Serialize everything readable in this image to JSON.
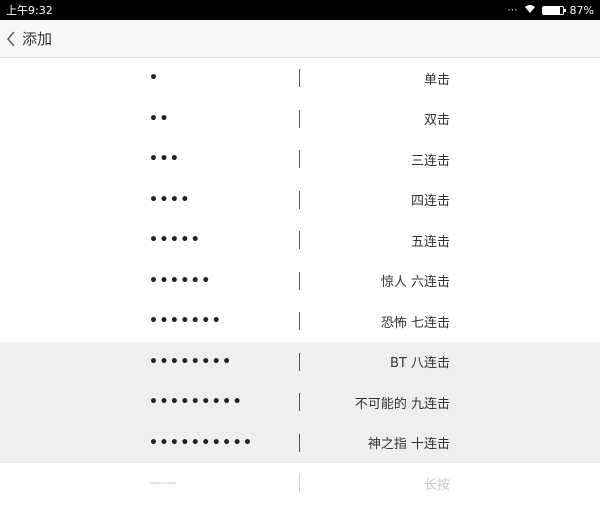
{
  "status_bar": {
    "time": "上午9:32",
    "battery": "87%",
    "battery_level": 0.87
  },
  "header": {
    "back_label": "添加"
  },
  "rows": [
    {
      "pattern": "•",
      "label": "单击",
      "state": "normal"
    },
    {
      "pattern": "••",
      "label": "双击",
      "state": "normal"
    },
    {
      "pattern": "•••",
      "label": "三连击",
      "state": "normal"
    },
    {
      "pattern": "••••",
      "label": "四连击",
      "state": "normal"
    },
    {
      "pattern": "•••••",
      "label": "五连击",
      "state": "normal"
    },
    {
      "pattern": "••••••",
      "label": "惊人 六连击",
      "state": "normal"
    },
    {
      "pattern": "•••••••",
      "label": "恐怖 七连击",
      "state": "normal"
    },
    {
      "pattern": "••••••••",
      "label": "BT 八连击",
      "state": "highlight"
    },
    {
      "pattern": "•••••••••",
      "label": "不可能的 九连击",
      "state": "highlight"
    },
    {
      "pattern": "••••••••••",
      "label": "神之指 十连击",
      "state": "highlight"
    },
    {
      "pattern": "——",
      "label": "长按",
      "state": "disabled"
    }
  ]
}
